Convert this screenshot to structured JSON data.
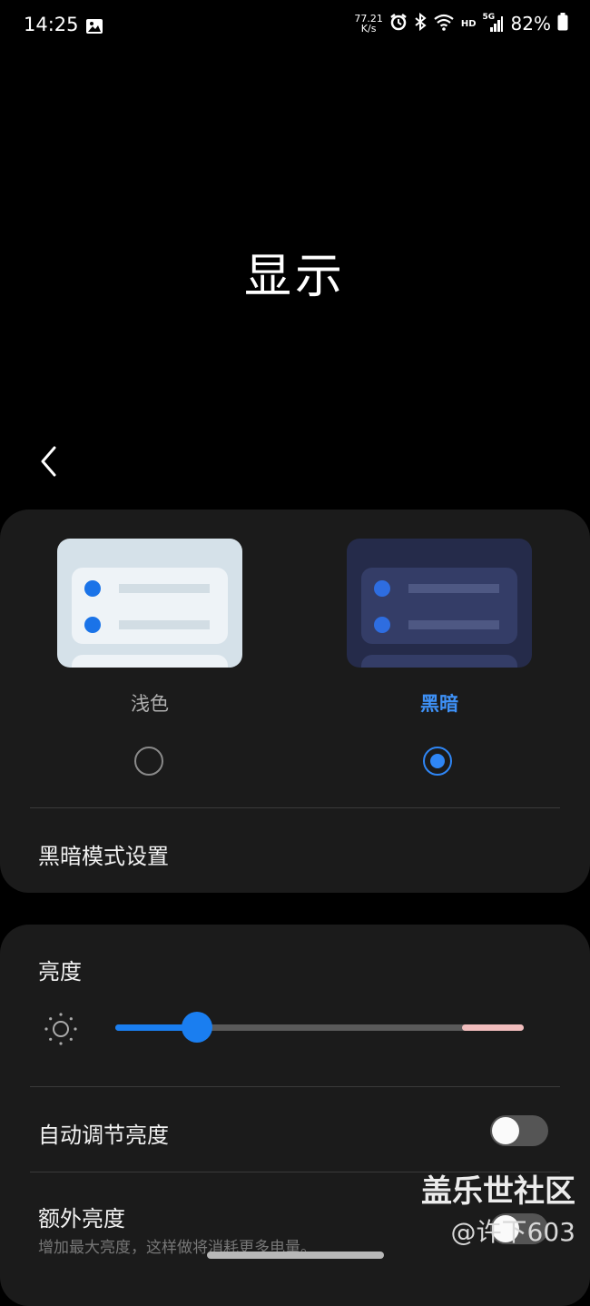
{
  "status_bar": {
    "time": "14:25",
    "net_speed_value": "77.21",
    "net_speed_unit": "K/s",
    "hd": "HD",
    "network": "5G",
    "battery": "82%"
  },
  "page": {
    "title": "显示"
  },
  "theme": {
    "light_label": "浅色",
    "dark_label": "黑暗",
    "selected": "dark",
    "dark_mode_settings_label": "黑暗模式设置"
  },
  "brightness": {
    "title": "亮度",
    "level": 0.2,
    "adaptive_label": "自动调节亮度",
    "adaptive_on": false,
    "extra_label": "额外亮度",
    "extra_desc": "增加最大亮度，这样做将消耗更多电量。"
  },
  "watermark": {
    "title": "盖乐世社区",
    "user": "@许下603"
  },
  "colors": {
    "accent": "#2f86f5",
    "card_bg": "#1b1b1b",
    "background": "#000000"
  },
  "icons": [
    "image-icon",
    "alarm-icon",
    "bluetooth-icon",
    "wifi-icon",
    "signal-icon",
    "battery-icon",
    "back-icon",
    "sun-icon"
  ]
}
